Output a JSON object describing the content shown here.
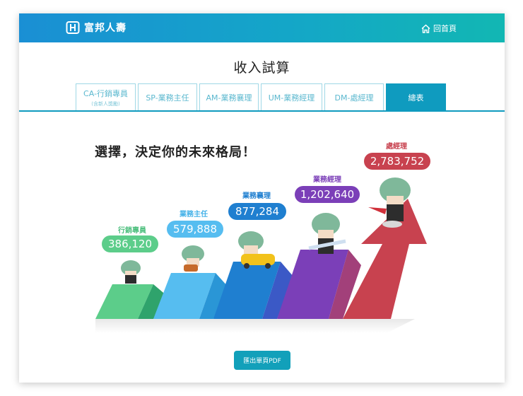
{
  "header": {
    "brand": "富邦人壽",
    "home_label": "回首頁",
    "colors": {
      "gradient_start": "#1a8fd4",
      "gradient_end": "#12b7b3"
    }
  },
  "page_title": "收入試算",
  "tabs": [
    {
      "label": "CA-行銷專員",
      "sub": "(含新人獎勵)",
      "active": false
    },
    {
      "label": "SP-業務主任",
      "active": false
    },
    {
      "label": "AM-業務襄理",
      "active": false
    },
    {
      "label": "UM-業務經理",
      "active": false
    },
    {
      "label": "DM-處經理",
      "active": false
    },
    {
      "label": "總表",
      "active": true
    }
  ],
  "slogan": "選擇，決定你的未來格局！",
  "levels": [
    {
      "name": "行銷專員",
      "amount": "386,120",
      "color": "#5ccd8a"
    },
    {
      "name": "業務主任",
      "amount": "579,888",
      "color": "#56bdf0"
    },
    {
      "name": "業務襄理",
      "amount": "877,284",
      "color": "#1f7fd0"
    },
    {
      "name": "業務經理",
      "amount": "1,202,640",
      "color": "#7b3fb8"
    },
    {
      "name": "處經理",
      "amount": "2,783,752",
      "color": "#c8424f"
    }
  ],
  "export_label": "匯出單頁PDF",
  "icons": {
    "brand": "fubon-logo-icon",
    "home": "home-icon"
  }
}
